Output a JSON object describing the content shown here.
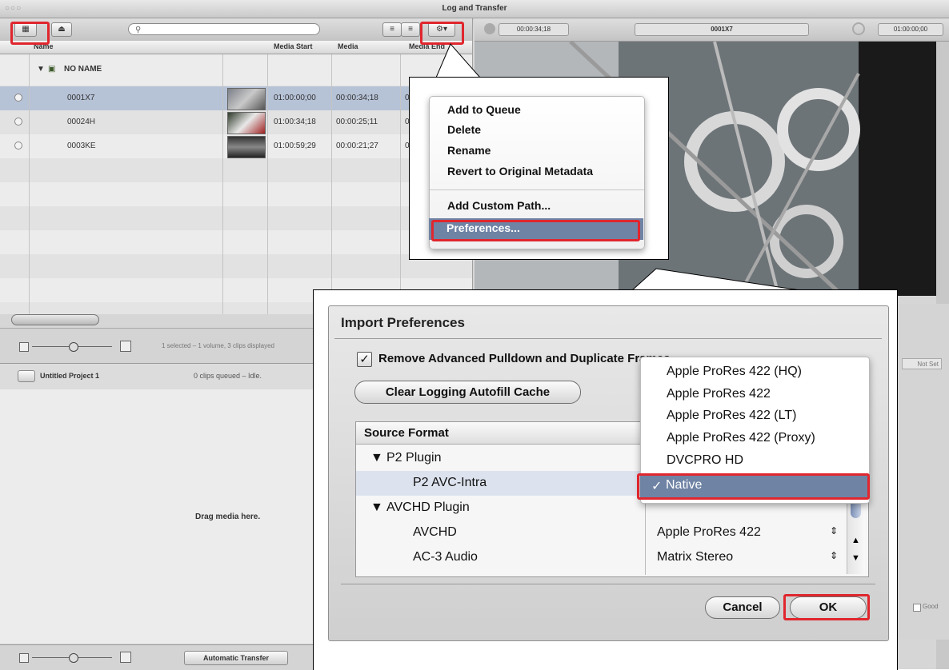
{
  "window": {
    "title": "Log and Transfer",
    "traffic_lights": "○○○"
  },
  "browser": {
    "search_placeholder": "",
    "columns": {
      "name": "Name",
      "media_start": "Media Start",
      "media_duration": "Media",
      "media_end": "Media End"
    },
    "volume": {
      "label": "NO NAME"
    },
    "clips": [
      {
        "name": "0001X7",
        "media_start": "01:00:00;00",
        "duration": "00:00:34;18",
        "end": "0"
      },
      {
        "name": "00024H",
        "media_start": "01:00:34;18",
        "duration": "00:00:25;11",
        "end": "0"
      },
      {
        "name": "0003KE",
        "media_start": "01:00:59;29",
        "duration": "00:00:21;27",
        "end": "0"
      }
    ],
    "status": "1 selected – 1 volume, 3 clips displayed"
  },
  "queue": {
    "project": "Untitled Project 1",
    "status": "0 clips queued – Idle.",
    "drop_hint": "Drag media here.",
    "transfer_button": "Automatic Transfer"
  },
  "viewer": {
    "current_timecode": "00:00:34;18",
    "clip_name": "0001X7",
    "duration_timecode": "01:00:00;00"
  },
  "right_panel": {
    "not_set": "Not Set",
    "good": "Good"
  },
  "gear_menu": {
    "items": [
      "Add to Queue",
      "Delete",
      "Rename",
      "Revert to Original Metadata",
      "Add Custom Path...",
      "Preferences..."
    ]
  },
  "prefs": {
    "title": "Import Preferences",
    "checkbox_label": "Remove Advanced Pulldown and Duplicate Frames",
    "checkbox_checked": true,
    "clear_cache_button": "Clear Logging Autofill Cache",
    "table_header": "Source Format",
    "rows": [
      {
        "source": "P2 Plugin",
        "target": ""
      },
      {
        "source": "P2 AVC-Intra",
        "target": ""
      },
      {
        "source": "AVCHD Plugin",
        "target": ""
      },
      {
        "source": "AVCHD",
        "target": "Apple ProRes 422"
      },
      {
        "source": "AC-3 Audio",
        "target": "Matrix Stereo"
      }
    ],
    "dropdown_options": [
      "Apple ProRes 422 (HQ)",
      "Apple ProRes 422",
      "Apple ProRes 422 (LT)",
      "Apple ProRes 422 (Proxy)",
      "DVCPRO HD",
      "Native"
    ],
    "dropdown_selected": "Native",
    "checkmark": "✓",
    "cancel_button": "Cancel",
    "ok_button": "OK"
  },
  "colors": {
    "highlight": "#e0262e",
    "selection": "#6f83a4"
  }
}
